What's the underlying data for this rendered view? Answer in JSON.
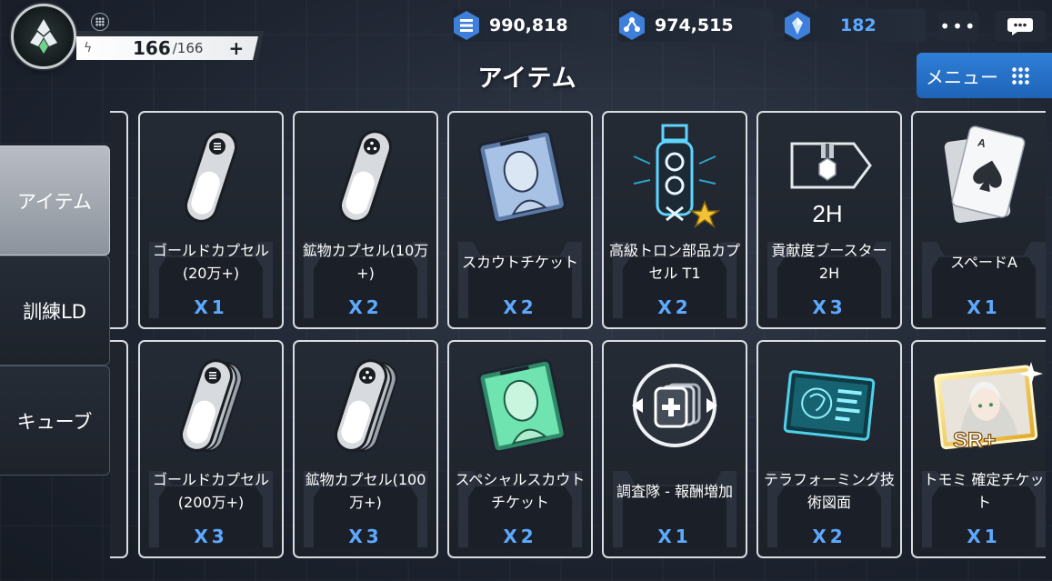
{
  "stamina": {
    "current": "166",
    "max": "/166",
    "plus": "+"
  },
  "currency": [
    {
      "icon": "gold-icon",
      "value": "990,818"
    },
    {
      "icon": "mineral-icon",
      "value": "974,515"
    },
    {
      "icon": "crystal-icon",
      "value": "182"
    }
  ],
  "more_label": "•••",
  "title": "アイテム",
  "menu_label": "メニュー",
  "side_tabs": [
    "アイテム",
    "訓練LD",
    "キューブ"
  ],
  "items_row1": [
    {
      "name": "ゴールドカプセル(20万+)",
      "qty": "X1",
      "icon": "gold-capsule-icon"
    },
    {
      "name": "鉱物カプセル(10万+)",
      "qty": "X2",
      "icon": "mineral-capsule-icon"
    },
    {
      "name": "スカウトチケット",
      "qty": "X2",
      "icon": "scout-ticket-icon"
    },
    {
      "name": "高級トロン部品カプセル T1",
      "qty": "X2",
      "icon": "tron-part-icon"
    },
    {
      "name": "貢献度ブースター2H",
      "qty": "X3",
      "icon": "medal-booster-icon"
    },
    {
      "name": "スペードA",
      "qty": "X1",
      "icon": "spade-card-icon"
    }
  ],
  "items_row2": [
    {
      "name": "ゴールドカプセル(200万+)",
      "qty": "X3",
      "icon": "gold-capsule-stack-icon"
    },
    {
      "name": "鉱物カプセル(100万+)",
      "qty": "X3",
      "icon": "mineral-capsule-stack-icon"
    },
    {
      "name": "スペシャルスカウトチケット",
      "qty": "X2",
      "icon": "special-scout-ticket-icon"
    },
    {
      "name": "調査隊 - 報酬増加",
      "qty": "X1",
      "icon": "reward-boost-icon"
    },
    {
      "name": "テラフォーミング技術図面",
      "qty": "X2",
      "icon": "blueprint-icon"
    },
    {
      "name": "トモミ 確定チケット",
      "qty": "X1",
      "icon": "sr-ticket-icon"
    }
  ],
  "booster_label": "2H",
  "sr_label": "SR+",
  "colors": {
    "accent": "#5da9ff",
    "menu": "#2f7fd7"
  }
}
